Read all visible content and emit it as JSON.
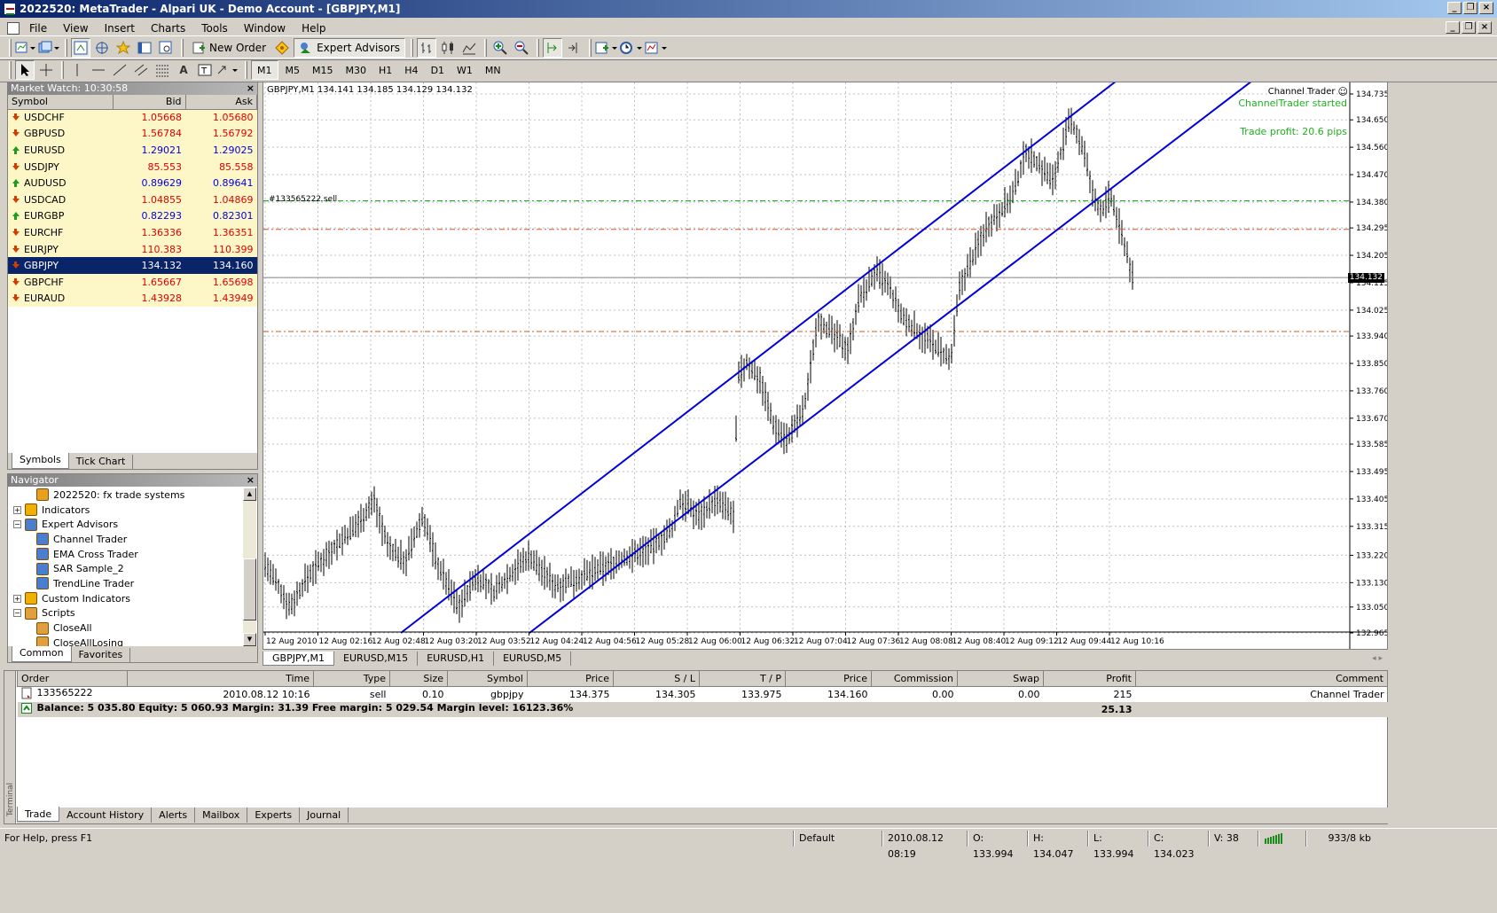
{
  "window": {
    "title": "2022520: MetaTrader - Alpari UK - Demo Account - [GBPJPY,M1]"
  },
  "menu": [
    "File",
    "View",
    "Insert",
    "Charts",
    "Tools",
    "Window",
    "Help"
  ],
  "toolbar": {
    "new_order": "New Order",
    "expert_advisors": "Expert Advisors",
    "timeframes": [
      "M1",
      "M5",
      "M15",
      "M30",
      "H1",
      "H4",
      "D1",
      "W1",
      "MN"
    ]
  },
  "market_watch": {
    "title": "Market Watch: 10:30:58",
    "headers": {
      "symbol": "Symbol",
      "bid": "Bid",
      "ask": "Ask"
    },
    "rows": [
      {
        "symbol": "USDCHF",
        "bid": "1.05668",
        "ask": "1.05680",
        "dir": "dn",
        "color": "red"
      },
      {
        "symbol": "GBPUSD",
        "bid": "1.56784",
        "ask": "1.56792",
        "dir": "dn",
        "color": "red"
      },
      {
        "symbol": "EURUSD",
        "bid": "1.29021",
        "ask": "1.29025",
        "dir": "up",
        "color": "blue"
      },
      {
        "symbol": "USDJPY",
        "bid": "85.553",
        "ask": "85.558",
        "dir": "dn",
        "color": "red"
      },
      {
        "symbol": "AUDUSD",
        "bid": "0.89629",
        "ask": "0.89641",
        "dir": "up",
        "color": "blue"
      },
      {
        "symbol": "USDCAD",
        "bid": "1.04855",
        "ask": "1.04869",
        "dir": "dn",
        "color": "red"
      },
      {
        "symbol": "EURGBP",
        "bid": "0.82293",
        "ask": "0.82301",
        "dir": "up",
        "color": "blue"
      },
      {
        "symbol": "EURCHF",
        "bid": "1.36336",
        "ask": "1.36351",
        "dir": "dn",
        "color": "red"
      },
      {
        "symbol": "EURJPY",
        "bid": "110.383",
        "ask": "110.399",
        "dir": "dn",
        "color": "red"
      },
      {
        "symbol": "GBPJPY",
        "bid": "134.132",
        "ask": "134.160",
        "dir": "dn",
        "color": "white",
        "selected": true
      },
      {
        "symbol": "GBPCHF",
        "bid": "1.65667",
        "ask": "1.65698",
        "dir": "dn",
        "color": "red"
      },
      {
        "symbol": "EURAUD",
        "bid": "1.43928",
        "ask": "1.43949",
        "dir": "dn",
        "color": "red"
      }
    ],
    "tabs": [
      "Symbols",
      "Tick Chart"
    ]
  },
  "navigator": {
    "title": "Navigator",
    "items": [
      {
        "label": "2022520: fx trade systems",
        "level": 2,
        "icon": "account-icon"
      },
      {
        "label": "Indicators",
        "level": 0,
        "icon": "indicators-icon",
        "exp": "+"
      },
      {
        "label": "Expert Advisors",
        "level": 0,
        "icon": "experts-icon",
        "exp": "−"
      },
      {
        "label": "Channel Trader",
        "level": 1,
        "icon": "expert-icon"
      },
      {
        "label": "EMA Cross Trader",
        "level": 1,
        "icon": "expert-icon"
      },
      {
        "label": "SAR Sample_2",
        "level": 1,
        "icon": "expert-icon"
      },
      {
        "label": "TrendLine Trader",
        "level": 1,
        "icon": "expert-icon"
      },
      {
        "label": "Custom Indicators",
        "level": 0,
        "icon": "custom-indicators-icon",
        "exp": "+"
      },
      {
        "label": "Scripts",
        "level": 0,
        "icon": "scripts-icon",
        "exp": "−"
      },
      {
        "label": "CloseAll",
        "level": 1,
        "icon": "script-icon"
      },
      {
        "label": "CloseAllLosing",
        "level": 1,
        "icon": "script-icon"
      }
    ],
    "tabs": [
      "Common",
      "Favorites"
    ]
  },
  "chart": {
    "header": "GBPJPY,M1  134.141 134.185 134.129 134.132",
    "ea_name": "Channel Trader",
    "ea_status": "ChannelTrader started",
    "trade_profit": "Trade profit: 20.6 pips",
    "order_label": "#133565222 sell",
    "last_price": "134.132",
    "y_ticks": [
      "134.735",
      "134.650",
      "134.560",
      "134.470",
      "134.380",
      "134.295",
      "134.205",
      "134.115",
      "134.025",
      "133.940",
      "133.850",
      "133.760",
      "133.670",
      "133.585",
      "133.495",
      "133.405",
      "133.315",
      "133.220",
      "133.130",
      "133.050",
      "132.965"
    ],
    "x_ticks": [
      "12 Aug 2010",
      "12 Aug 02:16",
      "12 Aug 02:48",
      "12 Aug 03:20",
      "12 Aug 03:52",
      "12 Aug 04:24",
      "12 Aug 04:56",
      "12 Aug 05:28",
      "12 Aug 06:00",
      "12 Aug 06:32",
      "12 Aug 07:04",
      "12 Aug 07:36",
      "12 Aug 08:08",
      "12 Aug 08:40",
      "12 Aug 09:12",
      "12 Aug 09:44",
      "12 Aug 10:16"
    ],
    "tabs": [
      "GBPJPY,M1",
      "EURUSD,M15",
      "EURUSD,H1",
      "EURUSD,M5"
    ],
    "colors": {
      "channel": "#0000dd",
      "tp_line": "#00a000",
      "sl_line": "#e05020",
      "profit_text": "#20b020",
      "bars": "#000000"
    }
  },
  "terminal": {
    "side_label": "Terminal",
    "headers": [
      "Order",
      "Time",
      "Type",
      "Size",
      "Symbol",
      "Price",
      "S / L",
      "T / P",
      "Price",
      "Commission",
      "Swap",
      "Profit",
      "Comment"
    ],
    "order": {
      "order": "133565222",
      "time": "2010.08.12 10:16",
      "type": "sell",
      "size": "0.10",
      "symbol": "gbpjpy",
      "price": "134.375",
      "sl": "134.305",
      "tp": "133.975",
      "cur_price": "134.160",
      "commission": "0.00",
      "swap": "0.00",
      "profit": "215",
      "comment": "Channel Trader"
    },
    "balance_line": "Balance: 5 035.80  Equity: 5 060.93  Margin: 31.39  Free margin: 5 029.54  Margin level: 16123.36%",
    "balance_profit": "25.13",
    "tabs": [
      "Trade",
      "Account History",
      "Alerts",
      "Mailbox",
      "Experts",
      "Journal"
    ]
  },
  "status": {
    "help": "For Help, press F1",
    "profile": "Default",
    "datetime": "2010.08.12 08:19",
    "open": "O: 133.994",
    "high": "H: 134.047",
    "low": "L: 133.994",
    "close": "C: 134.023",
    "volume": "V: 38",
    "traffic": "933/8 kb"
  }
}
